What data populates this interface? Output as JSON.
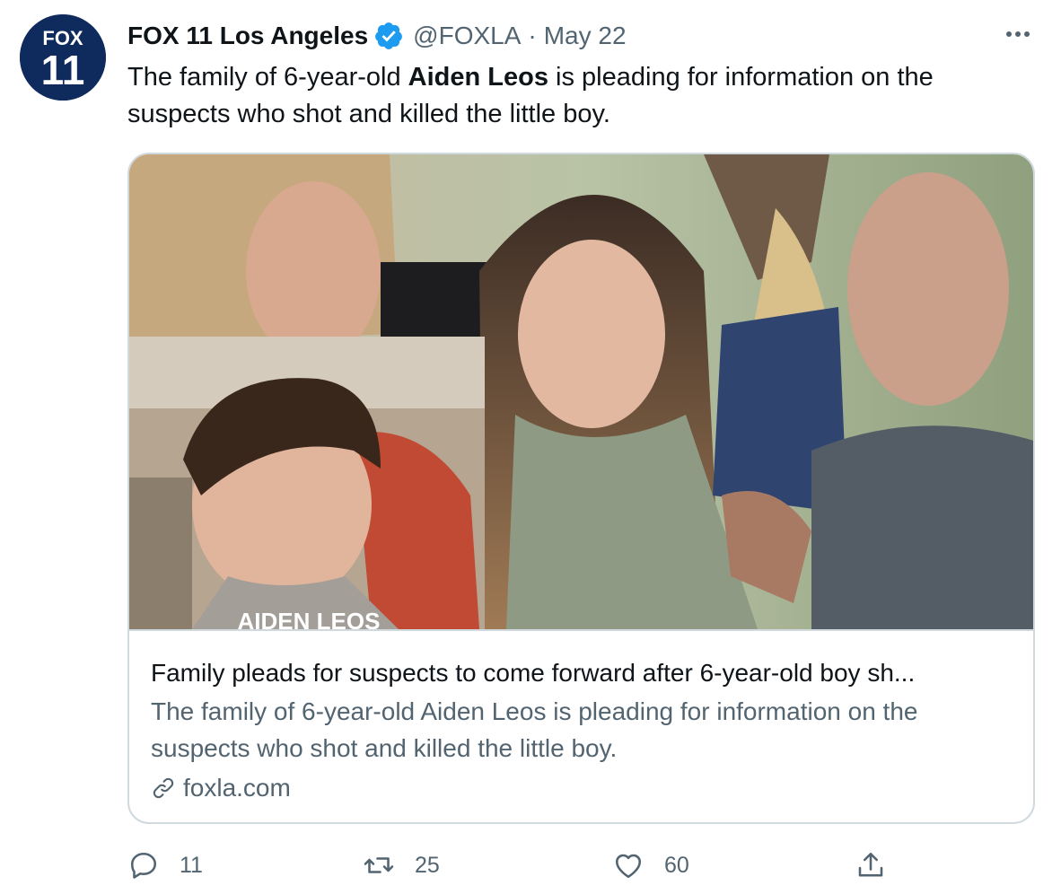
{
  "tweet": {
    "display_name": "FOX 11 Los Angeles",
    "handle": "@FOXLA",
    "separator": "·",
    "date": "May 22",
    "text_before": "The family of 6-year-old ",
    "text_bold": "Aiden Leos",
    "text_after": " is pleading for information on the suspects who shot and killed the little boy."
  },
  "avatar": {
    "line1": "FOX",
    "line2": "11"
  },
  "card": {
    "inset_caption": "AIDEN LEOS",
    "title": "Family pleads for suspects to come forward after 6-year-old boy sh...",
    "description": "The family of 6-year-old Aiden Leos is pleading for information on the suspects who shot and killed the little boy.",
    "domain": "foxla.com"
  },
  "actions": {
    "reply_count": "11",
    "retweet_count": "25",
    "like_count": "60"
  },
  "icons": {
    "verified": "verified-badge-icon",
    "more": "more-dots-icon",
    "link": "link-icon",
    "reply": "reply-icon",
    "retweet": "retweet-icon",
    "like": "heart-icon",
    "share": "share-icon"
  },
  "colors": {
    "verified_blue": "#1d9bf0",
    "secondary_text": "#536471",
    "border": "#cfd9de",
    "avatar_navy": "#0f2a5c"
  }
}
